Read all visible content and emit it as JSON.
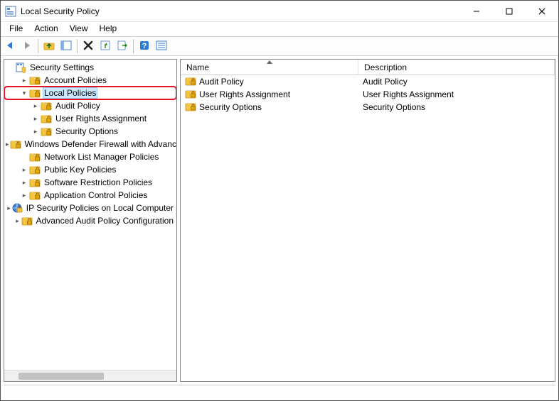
{
  "window": {
    "title": "Local Security Policy"
  },
  "menu": {
    "items": [
      "File",
      "Action",
      "View",
      "Help"
    ]
  },
  "toolbar": {
    "buttons": [
      "back",
      "forward",
      "up",
      "show-hide-tree",
      "delete",
      "refresh",
      "export",
      "help",
      "view-list"
    ]
  },
  "tree": {
    "root": {
      "label": "Security Settings",
      "expanded": true,
      "icon": "security-root-icon"
    },
    "nodes": [
      {
        "label": "Account Policies",
        "icon": "policy-folder-icon",
        "expander": ">",
        "level": 1,
        "selected": false
      },
      {
        "label": "Local Policies",
        "icon": "policy-folder-icon",
        "expander": "v",
        "level": 1,
        "selected": true,
        "highlighted": true
      },
      {
        "label": "Audit Policy",
        "icon": "policy-folder-icon",
        "expander": ">",
        "level": 2,
        "selected": false
      },
      {
        "label": "User Rights Assignment",
        "icon": "policy-folder-icon",
        "expander": ">",
        "level": 2,
        "selected": false
      },
      {
        "label": "Security Options",
        "icon": "policy-folder-icon",
        "expander": ">",
        "level": 2,
        "selected": false
      },
      {
        "label": "Windows Defender Firewall with Advanced Security",
        "icon": "policy-folder-icon",
        "expander": ">",
        "level": 1,
        "selected": false
      },
      {
        "label": "Network List Manager Policies",
        "icon": "policy-folder-icon",
        "expander": "",
        "level": 1,
        "selected": false
      },
      {
        "label": "Public Key Policies",
        "icon": "policy-folder-icon",
        "expander": ">",
        "level": 1,
        "selected": false
      },
      {
        "label": "Software Restriction Policies",
        "icon": "policy-folder-icon",
        "expander": ">",
        "level": 1,
        "selected": false
      },
      {
        "label": "Application Control Policies",
        "icon": "policy-folder-icon",
        "expander": ">",
        "level": 1,
        "selected": false
      },
      {
        "label": "IP Security Policies on Local Computer",
        "icon": "ipsec-icon",
        "expander": ">",
        "level": 1,
        "selected": false
      },
      {
        "label": "Advanced Audit Policy Configuration",
        "icon": "policy-folder-icon",
        "expander": ">",
        "level": 1,
        "selected": false
      }
    ]
  },
  "list": {
    "columns": {
      "name": "Name",
      "description": "Description"
    },
    "sort_column": "name",
    "rows": [
      {
        "name": "Audit Policy",
        "description": "Audit Policy",
        "icon": "policy-folder-icon"
      },
      {
        "name": "User Rights Assignment",
        "description": "User Rights Assignment",
        "icon": "policy-folder-icon"
      },
      {
        "name": "Security Options",
        "description": "Security Options",
        "icon": "policy-folder-icon"
      }
    ]
  }
}
